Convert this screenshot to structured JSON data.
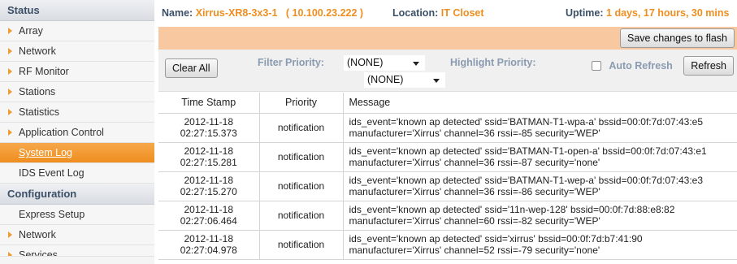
{
  "sidebar": {
    "status_header": "Status",
    "status_items": [
      {
        "label": "Array",
        "arrow": true
      },
      {
        "label": "Network",
        "arrow": true
      },
      {
        "label": "RF Monitor",
        "arrow": true
      },
      {
        "label": "Stations",
        "arrow": true
      },
      {
        "label": "Statistics",
        "arrow": true
      },
      {
        "label": "Application Control",
        "arrow": true
      },
      {
        "label": "System Log",
        "arrow": false,
        "active": true
      },
      {
        "label": "IDS Event Log",
        "arrow": false
      }
    ],
    "config_header": "Configuration",
    "config_items": [
      {
        "label": "Express Setup",
        "arrow": false
      },
      {
        "label": "Network",
        "arrow": true
      },
      {
        "label": "Services",
        "arrow": true
      }
    ]
  },
  "topbar": {
    "name_label": "Name:",
    "name_value": "Xirrus-XR8-3x3-1   ( 10.100.23.222 )",
    "location_label": "Location:",
    "location_value": "IT Closet",
    "uptime_label": "Uptime:",
    "uptime_value": "1 days, 17 hours, 30 mins"
  },
  "toolbar": {
    "save_label": "Save changes to flash",
    "clear_label": "Clear All",
    "filter_label": "Filter Priority:",
    "filter_value": "(NONE)",
    "highlight_label": "Highlight Priority:",
    "highlight_value": "(NONE)",
    "auto_refresh_label": "Auto Refresh",
    "auto_refresh_checked": false,
    "refresh_label": "Refresh"
  },
  "log": {
    "columns": [
      "Time Stamp",
      "Priority",
      "Message"
    ],
    "rows": [
      {
        "date": "2012-11-18",
        "time": "02:27:15.373",
        "priority": "notification",
        "line1": "ids_event='known ap detected' ssid='BATMAN-T1-wpa-a' bssid=00:0f:7d:07:43:e5",
        "line2": "manufacturer='Xirrus' channel=36 rssi=-85 security='WEP'"
      },
      {
        "date": "2012-11-18",
        "time": "02:27:15.281",
        "priority": "notification",
        "line1": "ids_event='known ap detected' ssid='BATMAN-T1-open-a' bssid=00:0f:7d:07:43:e1",
        "line2": "manufacturer='Xirrus' channel=36 rssi=-87 security='none'"
      },
      {
        "date": "2012-11-18",
        "time": "02:27:15.270",
        "priority": "notification",
        "line1": "ids_event='known ap detected' ssid='BATMAN-T1-wep-a' bssid=00:0f:7d:07:43:e3",
        "line2": "manufacturer='Xirrus' channel=36 rssi=-86 security='WEP'"
      },
      {
        "date": "2012-11-18",
        "time": "02:27:06.464",
        "priority": "notification",
        "line1": "ids_event='known ap detected' ssid='11n-wep-128' bssid=00:0f:7d:88:e8:82",
        "line2": "manufacturer='Xirrus' channel=60 rssi=-82 security='WEP'"
      },
      {
        "date": "2012-11-18",
        "time": "02:27:04.978",
        "priority": "notification",
        "line1": "ids_event='known ap detected' ssid='xirrus' bssid=00:0f:7d:b7:41:90",
        "line2": "manufacturer='Xirrus' channel=52 rssi=-79 security='none'"
      }
    ]
  },
  "colors": {
    "accent_orange": "#ef8e1f",
    "header_blue": "#3b4f66",
    "savebar_peach": "#f8c9a0"
  }
}
